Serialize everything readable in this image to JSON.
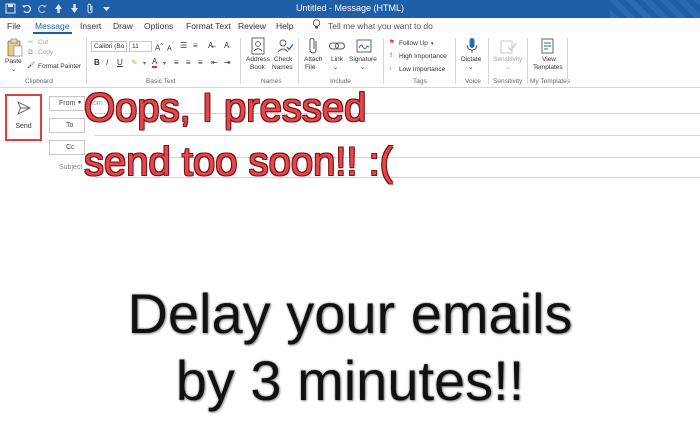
{
  "window": {
    "title": "Untitled - Message (HTML)"
  },
  "quick_access": [
    "save-icon",
    "undo-icon",
    "redo-icon",
    "up-arrow-icon",
    "down-arrow-icon",
    "paperclip-icon",
    "customize-icon"
  ],
  "tabs": [
    {
      "label": "File",
      "active": false
    },
    {
      "label": "Message",
      "active": true
    },
    {
      "label": "Insert",
      "active": false
    },
    {
      "label": "Draw",
      "active": false
    },
    {
      "label": "Options",
      "active": false
    },
    {
      "label": "Format Text",
      "active": false
    },
    {
      "label": "Review",
      "active": false
    },
    {
      "label": "Help",
      "active": false
    }
  ],
  "tell_me": "Tell me what you want to do",
  "ribbon": {
    "clipboard": {
      "paste": "Paste",
      "cut": "Cut",
      "copy": "Copy",
      "format_painter": "Format Painter",
      "group": "Clipboard"
    },
    "basic_text": {
      "font": "Calibri (Bo",
      "size": "11",
      "group": "Basic Text"
    },
    "names": {
      "address_book_1": "Address",
      "address_book_2": "Book",
      "check_names_1": "Check",
      "check_names_2": "Names",
      "group": "Names"
    },
    "include": {
      "attach_1": "Attach",
      "attach_2": "File",
      "link": "Link",
      "signature": "Signature",
      "group": "Include"
    },
    "tags": {
      "follow_up": "Follow Up",
      "high": "High Importance",
      "low": "Low Importance",
      "group": "Tags"
    },
    "voice": {
      "dictate": "Dictate",
      "group": "Voice"
    },
    "sensitivity": {
      "label": "Sensitivity",
      "group": "Sensitivity"
    },
    "templates": {
      "view_1": "View",
      "view_2": "Templates",
      "group": "My Templates"
    }
  },
  "compose": {
    "send": "Send",
    "from": "From",
    "from_value": "tom",
    "to": "To",
    "cc": "Cc",
    "subject": "Subject"
  },
  "overlay": {
    "line1": "Oops, I pressed",
    "line2": "send too soon!! :(",
    "headline1": "Delay your emails",
    "headline2": "by 3 minutes!!"
  },
  "colors": {
    "accent": "#1f5fa8",
    "highlight_border": "#d94040",
    "overlay_red": "#e2474b"
  }
}
